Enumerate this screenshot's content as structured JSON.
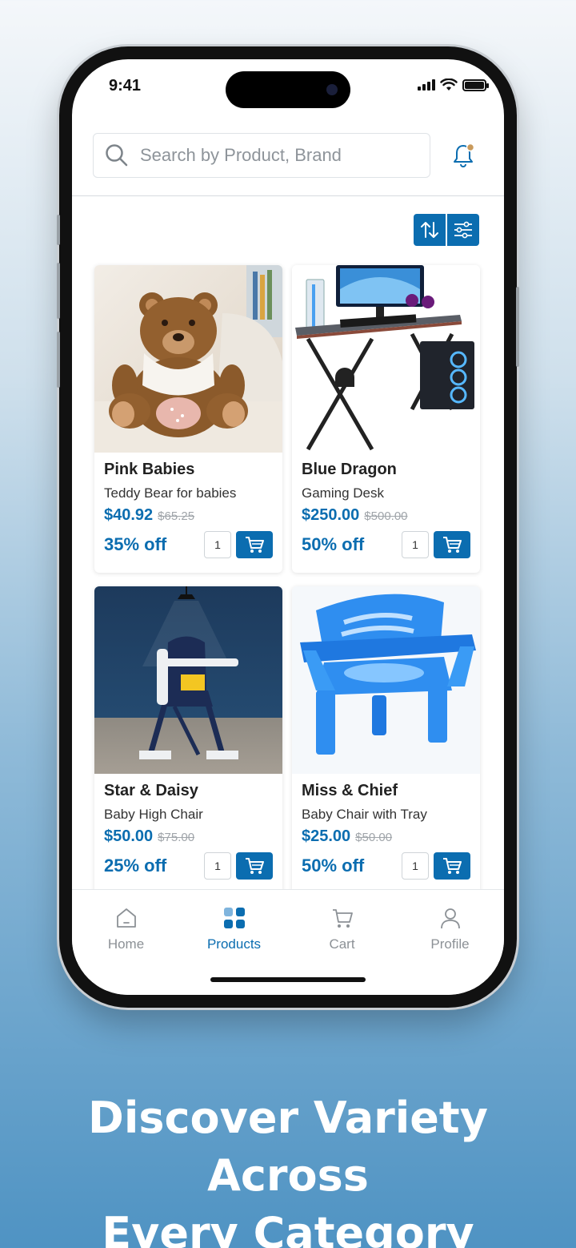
{
  "status": {
    "time": "9:41"
  },
  "search": {
    "placeholder": "Search by Product, Brand"
  },
  "products": [
    {
      "brand": "Pink Babies",
      "description": "Teddy Bear for babies",
      "price": "$40.92",
      "old_price": "$65.25",
      "discount": "35% off",
      "qty": "1",
      "image": "teddy-bear"
    },
    {
      "brand": "Blue Dragon",
      "description": "Gaming Desk",
      "price": "$250.00",
      "old_price": "$500.00",
      "discount": "50% off",
      "qty": "1",
      "image": "gaming-desk"
    },
    {
      "brand": "Star & Daisy",
      "description": "Baby High Chair",
      "price": "$50.00",
      "old_price": "$75.00",
      "discount": "25% off",
      "qty": "1",
      "image": "high-chair"
    },
    {
      "brand": "Miss & Chief",
      "description": "Baby Chair with Tray",
      "price": "$25.00",
      "old_price": "$50.00",
      "discount": "50% off",
      "qty": "1",
      "image": "baby-chair"
    }
  ],
  "tabs": [
    {
      "label": "Home",
      "icon": "home-icon",
      "active": false
    },
    {
      "label": "Products",
      "icon": "grid-icon",
      "active": true
    },
    {
      "label": "Cart",
      "icon": "cart-icon",
      "active": false
    },
    {
      "label": "Profile",
      "icon": "user-icon",
      "active": false
    }
  ],
  "headline": {
    "line1": "Discover Variety Across",
    "line2": "Every Category"
  },
  "colors": {
    "accent": "#0b6db0",
    "background_top": "#f4f7fa",
    "background_bottom": "#4f93c3"
  }
}
